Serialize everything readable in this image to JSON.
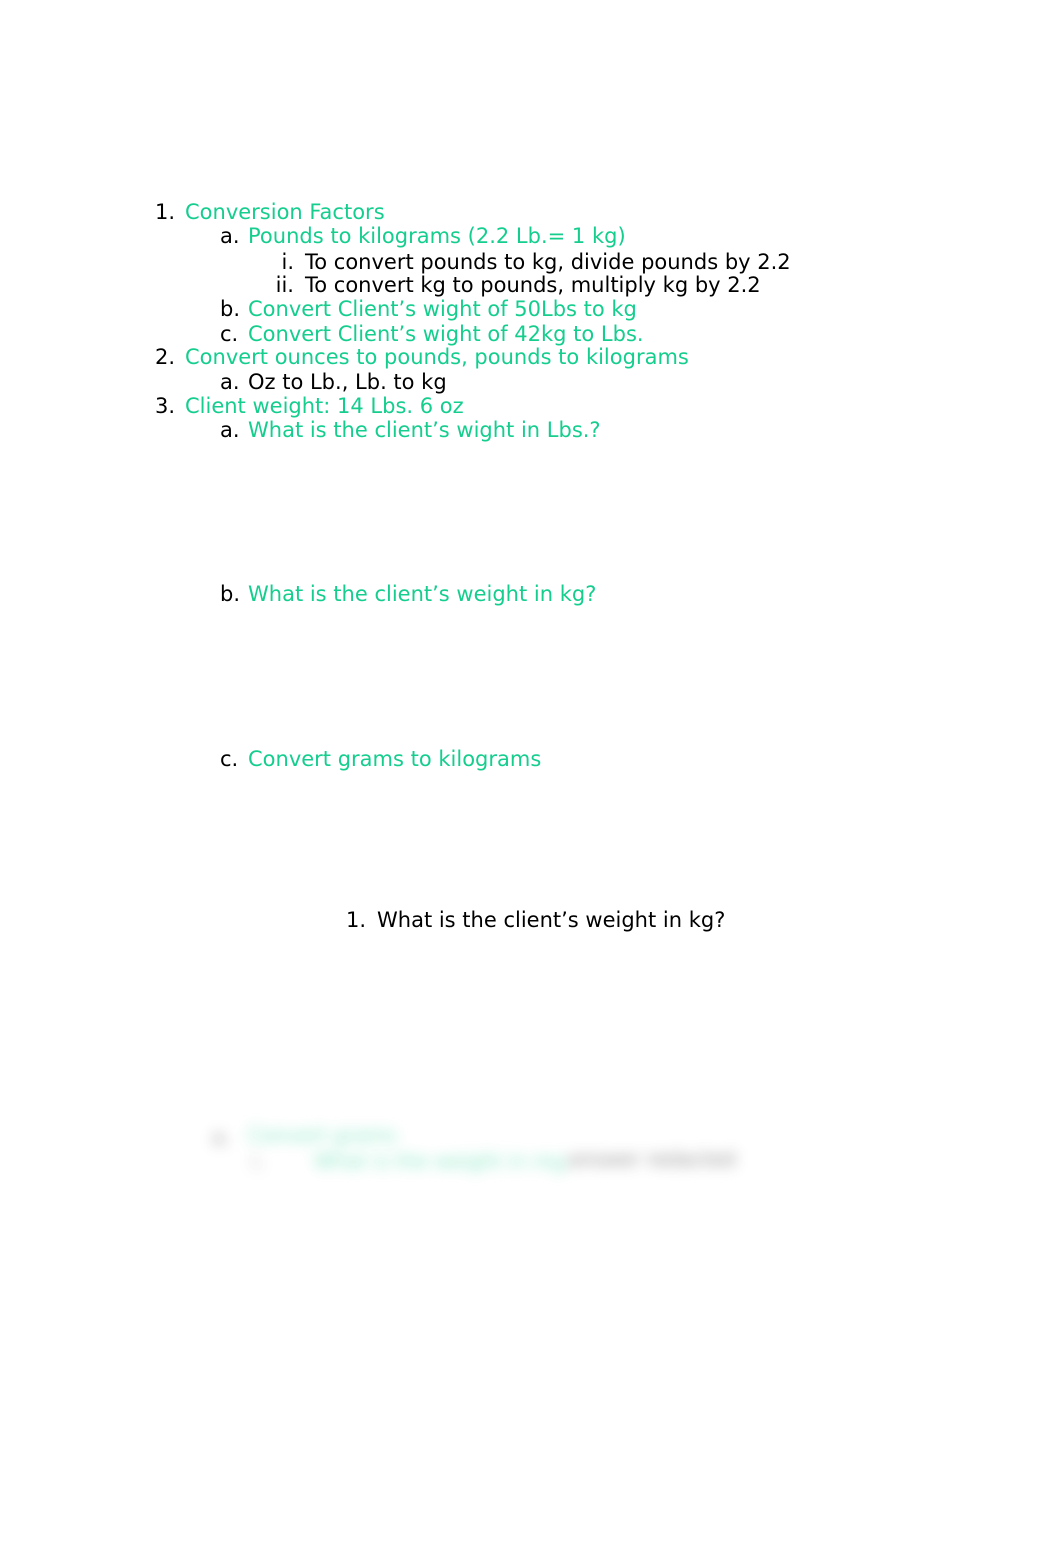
{
  "document": {
    "background_color": "#ffffff",
    "accent_color": "#15CE8E",
    "body_color": "#000000",
    "outline": [
      {
        "marker": "1.",
        "text": "Conversion Factors",
        "color": "green",
        "level": 1
      },
      {
        "marker": "a.",
        "text": "Pounds to kilograms (2.2 Lb.= 1 kg)",
        "color": "green",
        "level": 2
      },
      {
        "marker": "i.",
        "text": "To convert pounds to kg, divide pounds by 2.2",
        "color": "black",
        "level": 3
      },
      {
        "marker": "ii.",
        "text": "To convert kg to pounds, multiply kg by 2.2",
        "color": "black",
        "level": 3
      },
      {
        "marker": "b.",
        "text": "Convert Client’s wight of 50Lbs to kg",
        "color": "green",
        "level": 2
      },
      {
        "marker": "c.",
        "text": "Convert Client’s wight of 42kg to Lbs.",
        "color": "green",
        "level": 2
      },
      {
        "marker": "2.",
        "text": "Convert ounces to pounds, pounds to kilograms",
        "color": "green",
        "level": 1
      },
      {
        "marker": "a.",
        "text": "Oz to Lb., Lb. to kg",
        "color": "black",
        "level": 2
      },
      {
        "marker": "3.",
        "text": "Client weight: 14 Lbs. 6 oz",
        "color": "green",
        "level": 1
      },
      {
        "marker": "a.",
        "text": "What is the client’s wight in Lbs.?",
        "color": "green",
        "level": 2
      },
      {
        "marker": "b.",
        "text": "What is the client’s weight in kg?",
        "color": "green",
        "level": 2
      },
      {
        "marker": "c.",
        "text": "Convert grams to kilograms",
        "color": "green",
        "level": 2
      },
      {
        "marker": "1.",
        "text": "What is the client’s weight in kg?",
        "color": "black",
        "level": 4
      }
    ],
    "redacted_block": {
      "note": "illegible blurred text",
      "fragments": [
        "a.",
        "Convert grams",
        "i.",
        "What is the weight in mg",
        "answer redacted"
      ]
    }
  }
}
